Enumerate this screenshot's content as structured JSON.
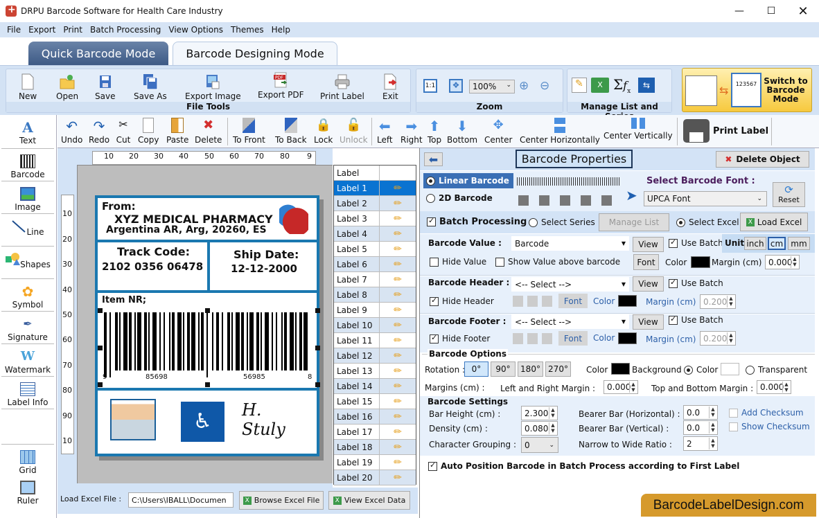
{
  "window": {
    "title": "DRPU Barcode Software for Health Care Industry",
    "controls": [
      "minimize",
      "maximize",
      "close"
    ]
  },
  "menu": [
    "File",
    "Export",
    "Print",
    "Batch Processing",
    "View Options",
    "Themes",
    "Help"
  ],
  "mode_tabs": {
    "quick": "Quick Barcode Mode",
    "designing": "Barcode Designing Mode",
    "active": "Barcode Designing Mode"
  },
  "ribbon": {
    "file_tools": {
      "title": "File Tools",
      "buttons": [
        "New",
        "Open",
        "Save",
        "Save As",
        "Export Image",
        "Export PDF",
        "Print Label",
        "Exit"
      ]
    },
    "zoom": {
      "title": "Zoom",
      "value": "100%"
    },
    "manage": {
      "title": "Manage List and Series"
    },
    "switch": {
      "label": "Switch to Barcode Mode",
      "preview_number": "123567"
    }
  },
  "left_tools": [
    "Text",
    "Barcode",
    "Image",
    "Line",
    "Shapes",
    "Symbol",
    "Signature",
    "Watermark",
    "Label Info"
  ],
  "left_bottom_tools": [
    "Grid",
    "Ruler"
  ],
  "edit_toolbar": {
    "buttons": [
      "Undo",
      "Redo",
      "Cut",
      "Copy",
      "Paste",
      "Delete",
      "To Front",
      "To Back",
      "Lock",
      "Unlock",
      "Left",
      "Right",
      "Top",
      "Bottom",
      "Center",
      "Center Horizontally",
      "Center Vertically"
    ],
    "disabled": [
      "Unlock"
    ],
    "print_label": "Print Label"
  },
  "rulers": {
    "top": [
      "10",
      "20",
      "30",
      "40",
      "50",
      "60",
      "70",
      "80",
      "9"
    ],
    "left": [
      "10",
      "20",
      "30",
      "40",
      "50",
      "60",
      "70",
      "80",
      "90",
      "10"
    ]
  },
  "label": {
    "from_title": "From:",
    "company": "XYZ MEDICAL PHARMACY",
    "address": "Argentina AR, Arg, 20260, ES",
    "track_title": "Track Code:",
    "track_code": "2102  0356  06478",
    "ship_title": "Ship Date:",
    "ship_date": "12-12-2000",
    "item_title": "Item NR;",
    "barcode_digits": {
      "left": "9",
      "group1": "85698",
      "group2": "56985",
      "right": "8"
    },
    "signature": "H. Stuly"
  },
  "label_list": {
    "header": "Label",
    "selected": "Label 1",
    "items": [
      "Label 1",
      "Label 2",
      "Label 3",
      "Label 4",
      "Label 5",
      "Label 6",
      "Label 7",
      "Label 8",
      "Label 9",
      "Label 10",
      "Label 11",
      "Label 12",
      "Label 13",
      "Label 14",
      "Label 15",
      "Label 16",
      "Label 17",
      "Label 18",
      "Label 19",
      "Label 20"
    ]
  },
  "bottom": {
    "load_label": "Load Excel File :",
    "path": "C:\\Users\\IBALL\\Documen",
    "browse": "Browse Excel File",
    "view": "View Excel Data"
  },
  "props": {
    "title": "Barcode Properties",
    "delete_object": "Delete Object",
    "linear": "Linear Barcode",
    "twod": "2D Barcode",
    "barcode_type_selected": "Linear Barcode",
    "font_label": "Select Barcode Font :",
    "font_value": "UPCA Font",
    "reset": "Reset",
    "batch": {
      "label": "Batch Processing",
      "checked": true,
      "select_series": "Select Series",
      "manage_list": "Manage List",
      "select_excel": "Select Excel",
      "selected_source": "Select Excel",
      "load_excel": "Load Excel"
    },
    "value": {
      "label": "Barcode Value :",
      "field": "Barcode",
      "view": "View",
      "use_batch": "Use Batch",
      "use_batch_checked": true,
      "unit_label": "Unit",
      "units": [
        "inch",
        "cm",
        "mm"
      ],
      "unit_selected": "cm",
      "hide_value": "Hide Value",
      "hide_value_checked": false,
      "show_above": "Show Value above barcode",
      "show_above_checked": false,
      "font": "Font",
      "color_label": "Color",
      "color": "#000000",
      "margin_label": "Margin (cm)",
      "margin": "0.000"
    },
    "header": {
      "label": "Barcode Header :",
      "field": "<-- Select -->",
      "view": "View",
      "use_batch": "Use Batch",
      "use_batch_checked": true,
      "hide": "Hide Header",
      "hide_checked": true,
      "font": "Font",
      "color_label": "Color",
      "color": "#000000",
      "margin_label": "Margin (cm)",
      "margin": "0.200"
    },
    "footer": {
      "label": "Barcode Footer :",
      "field": "<-- Select -->",
      "view": "View",
      "use_batch": "Use Batch",
      "use_batch_checked": true,
      "hide": "Hide Footer",
      "hide_checked": true,
      "font": "Font",
      "color_label": "Color",
      "color": "#000000",
      "margin_label": "Margin (cm)",
      "margin": "0.200"
    },
    "options": {
      "title": "Barcode Options",
      "rotation_label": "Rotation :",
      "rotations": [
        "0°",
        "90°",
        "180°",
        "270°"
      ],
      "rotation_selected": "0°",
      "color_label": "Color",
      "color": "#000000",
      "background_label": "Background",
      "bg_color_label": "Color",
      "bg_transparent_label": "Transparent",
      "bg_selected": "Color",
      "bg_color": "#ffffff",
      "margins_label": "Margins (cm) :",
      "lr_label": "Left and Right Margin :",
      "lr_value": "0.000",
      "tb_label": "Top and Bottom Margin :",
      "tb_value": "0.000"
    },
    "settings": {
      "title": "Barcode Settings",
      "bar_height_label": "Bar Height (cm) :",
      "bar_height": "2.300",
      "density_label": "Density (cm) :",
      "density": "0.080",
      "grouping_label": "Character Grouping  :",
      "grouping": "0",
      "bearer_h_label": "Bearer Bar (Horizontal) :",
      "bearer_h": "0.0",
      "bearer_v_label": "Bearer Bar (Vertical) :",
      "bearer_v": "0.0",
      "ratio_label": "Narrow to Wide Ratio :",
      "ratio": "2",
      "add_checksum": "Add Checksum",
      "show_checksum": "Show Checksum"
    },
    "auto_position": {
      "label": "Auto Position Barcode in Batch Process according to First Label",
      "checked": true
    }
  },
  "watermark": "BarcodeLabelDesign.com"
}
